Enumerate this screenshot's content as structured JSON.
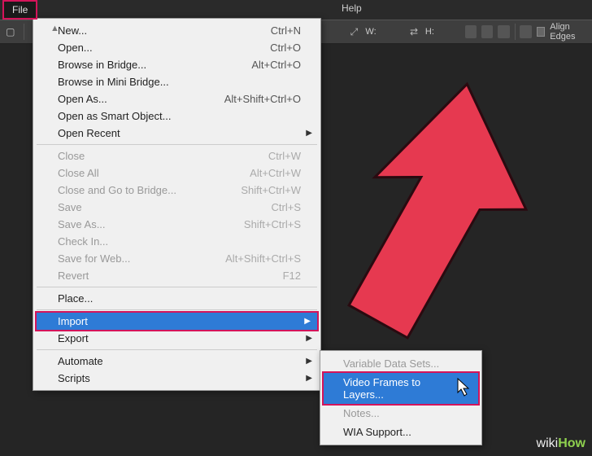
{
  "menubar": {
    "file": "File",
    "help": "Help"
  },
  "options": {
    "w_label": "W:",
    "h_label": "H:",
    "align_edges": "Align Edges"
  },
  "menu": {
    "new": "New...",
    "new_sc": "Ctrl+N",
    "open": "Open...",
    "open_sc": "Ctrl+O",
    "browse_bridge": "Browse in Bridge...",
    "browse_bridge_sc": "Alt+Ctrl+O",
    "browse_mini": "Browse in Mini Bridge...",
    "open_as": "Open As...",
    "open_as_sc": "Alt+Shift+Ctrl+O",
    "open_smart": "Open as Smart Object...",
    "open_recent": "Open Recent",
    "close": "Close",
    "close_sc": "Ctrl+W",
    "close_all": "Close All",
    "close_all_sc": "Alt+Ctrl+W",
    "close_goto": "Close and Go to Bridge...",
    "close_goto_sc": "Shift+Ctrl+W",
    "save": "Save",
    "save_sc": "Ctrl+S",
    "save_as": "Save As...",
    "save_as_sc": "Shift+Ctrl+S",
    "check_in": "Check In...",
    "save_web": "Save for Web...",
    "save_web_sc": "Alt+Shift+Ctrl+S",
    "revert": "Revert",
    "revert_sc": "F12",
    "place": "Place...",
    "import": "Import",
    "export": "Export",
    "automate": "Automate",
    "scripts": "Scripts"
  },
  "submenu": {
    "var_sets": "Variable Data Sets...",
    "video_frames": "Video Frames to Layers...",
    "notes": "Notes...",
    "wia": "WIA Support..."
  },
  "attribution": {
    "wiki": "wiki",
    "how": "How"
  },
  "colors": {
    "highlight_border": "#d4145a",
    "highlight_bg": "#2e7bd6",
    "arrow": "#e63950"
  }
}
